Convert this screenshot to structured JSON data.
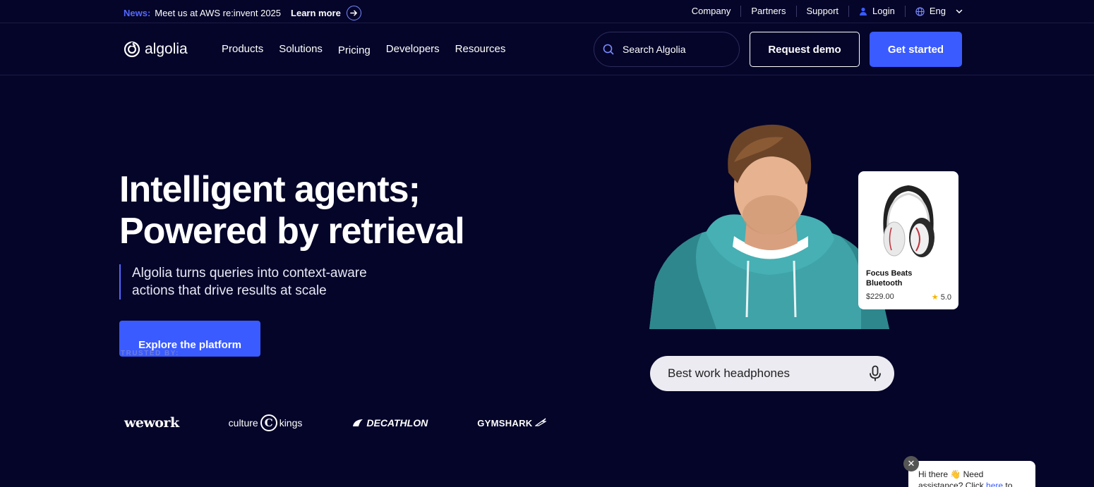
{
  "topbar": {
    "news_label": "News:",
    "news_text": "Meet us at AWS re:invent 2025",
    "learn_more": "Learn more",
    "links": [
      {
        "label": "Company"
      },
      {
        "label": "Partners"
      },
      {
        "label": "Support"
      },
      {
        "label": "Login",
        "icon": "user-icon"
      },
      {
        "label": "Eng",
        "icon": "globe-icon"
      }
    ]
  },
  "nav": {
    "logo_text": "algolia",
    "menu": [
      "Products",
      "Solutions",
      "Pricing",
      "Developers",
      "Resources"
    ],
    "search_placeholder": "Search Algolia",
    "request_demo": "Request demo",
    "get_started": "Get started"
  },
  "hero": {
    "title_line1": "Intelligent agents;",
    "title_line2": "Powered by retrieval",
    "subtitle": "Algolia turns queries into context-aware actions that drive results at scale",
    "cta": "Explore the platform",
    "trusted_by": "TRUSTED BY:",
    "logos": [
      "wework",
      "culture",
      "kings",
      "DECATHLON",
      "GYMSHARK"
    ]
  },
  "visual": {
    "product_name": "Focus Beats Bluetooth",
    "product_price": "$229.00",
    "product_rating": "5.0",
    "query_value": "Best work headphones"
  },
  "chat": {
    "line1": "Hi there 👋 Need",
    "line2_start": "assistance? Click ",
    "line2_link": "here",
    "line2_end": " to"
  },
  "colors": {
    "background": "#05052a",
    "accent": "#3a5bff",
    "news_label": "#5468ff"
  }
}
